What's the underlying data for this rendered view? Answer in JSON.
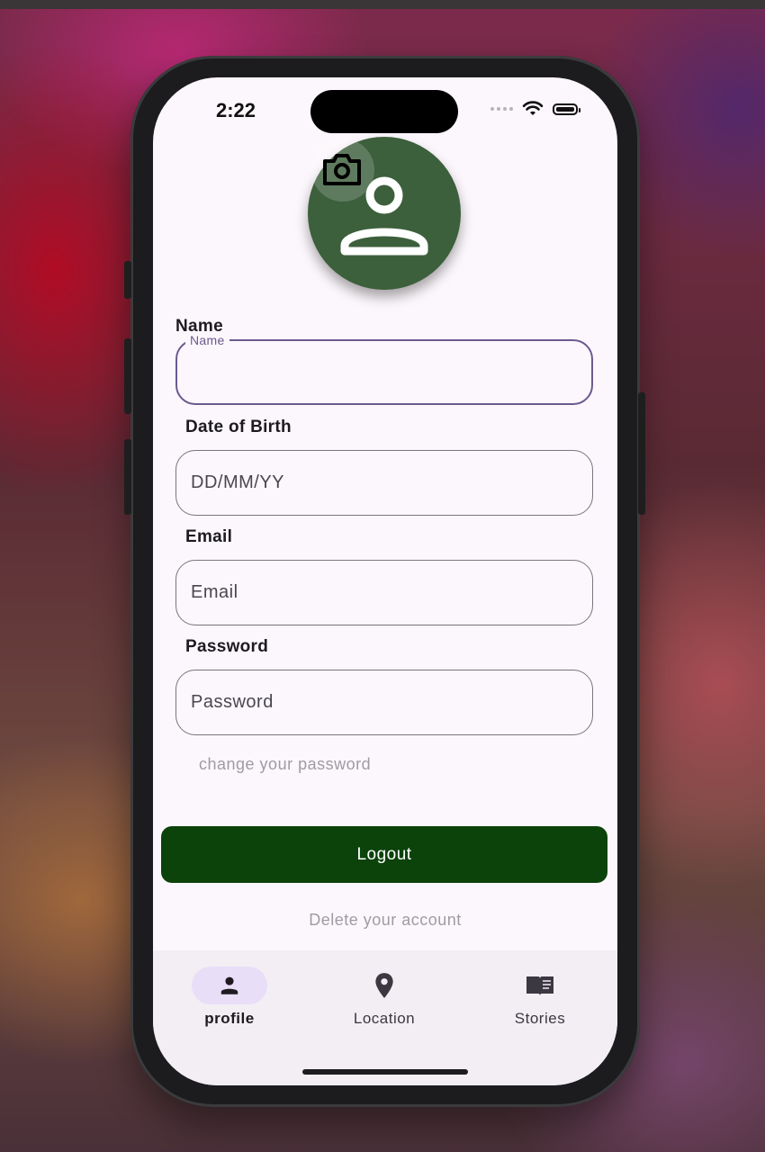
{
  "status_bar": {
    "time": "2:22"
  },
  "profile": {
    "name_label": "Name",
    "name_field_label": "Name",
    "name_value": "",
    "dob_label": "Date of Birth",
    "dob_placeholder": "DD/MM/YY",
    "email_label": "Email",
    "email_placeholder": "Email",
    "password_label": "Password",
    "password_placeholder": "Password",
    "change_password_link": "change your password",
    "logout_button": "Logout",
    "delete_account_link": "Delete your account"
  },
  "bottom_nav": {
    "items": [
      {
        "label": "profile",
        "icon": "person-icon",
        "active": true
      },
      {
        "label": "Location",
        "icon": "location-pin-icon",
        "active": false
      },
      {
        "label": "Stories",
        "icon": "book-icon",
        "active": false
      }
    ]
  },
  "colors": {
    "primary_button": "#0b430b",
    "avatar_bg": "#3c5f3c",
    "focus_outline": "#6b5a8e",
    "nav_active_pill": "#e8def8"
  }
}
